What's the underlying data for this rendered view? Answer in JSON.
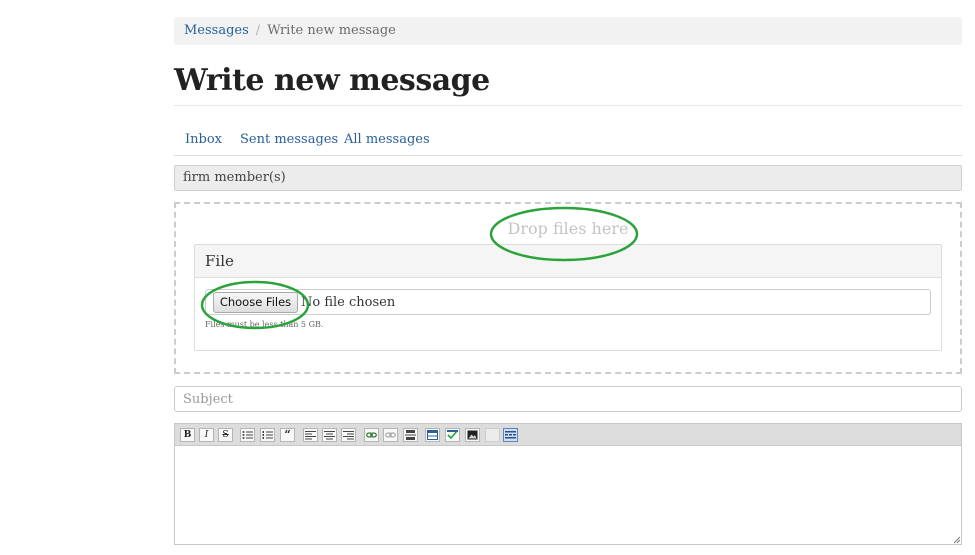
{
  "breadcrumb": {
    "parent": "Messages",
    "separator": "/",
    "current": "Write new message"
  },
  "page_title": "Write new message",
  "tabs": [
    {
      "label": "Inbox"
    },
    {
      "label": "Sent messages"
    },
    {
      "label": "All messages"
    }
  ],
  "recipients": {
    "value": "firm member(s)"
  },
  "dropzone": {
    "text": "Drop files here"
  },
  "file_panel": {
    "title": "File",
    "choose_button": "Choose Files",
    "no_file": "No file chosen",
    "help": "Files must be less than 5 GB."
  },
  "subject": {
    "placeholder": "Subject",
    "value": ""
  },
  "toolbar": {
    "buttons": [
      {
        "icon": "bold-icon",
        "glyph": "B"
      },
      {
        "icon": "italic-icon",
        "glyph": "I"
      },
      {
        "icon": "strikethrough-icon",
        "glyph": "S"
      },
      {
        "icon": "bullet-list-icon",
        "glyph": ""
      },
      {
        "icon": "numbered-list-icon",
        "glyph": ""
      },
      {
        "icon": "blockquote-icon",
        "glyph": "“"
      },
      {
        "icon": "align-left-icon",
        "glyph": ""
      },
      {
        "icon": "align-center-icon",
        "glyph": ""
      },
      {
        "icon": "align-right-icon",
        "glyph": ""
      },
      {
        "icon": "link-icon",
        "glyph": ""
      },
      {
        "icon": "unlink-icon",
        "glyph": ""
      },
      {
        "icon": "horizontal-rule-icon",
        "glyph": ""
      },
      {
        "icon": "table-icon",
        "glyph": ""
      },
      {
        "icon": "spellcheck-icon",
        "glyph": ""
      },
      {
        "icon": "image-icon",
        "glyph": ""
      },
      {
        "icon": "blank-icon",
        "glyph": ""
      },
      {
        "icon": "toggle-toolbar-icon",
        "glyph": ""
      }
    ]
  },
  "colors": {
    "link": "#2a6099",
    "annotation_green": "#2aa33a",
    "bar": "#f2f2f2"
  }
}
